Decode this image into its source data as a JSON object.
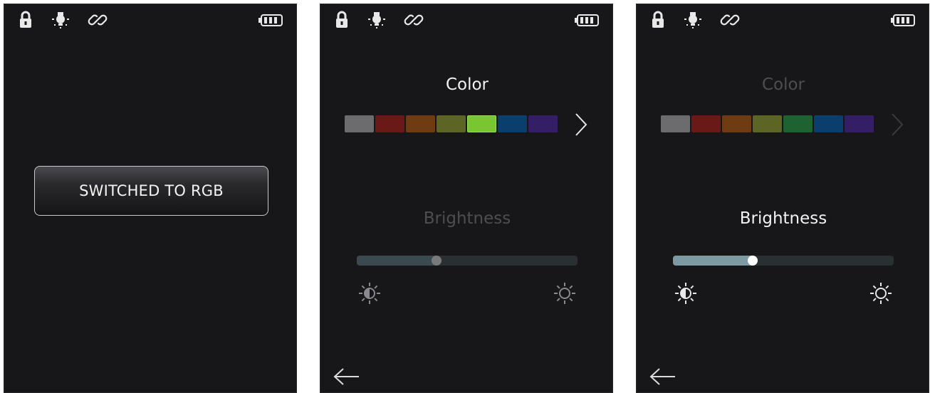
{
  "colors": {
    "screen_bg": "#171618",
    "text_active": "#f2f2f2",
    "text_dim": "#4e4d52",
    "icon_active": "#e8e8e8",
    "icon_dim": "#8a8a8e"
  },
  "icons": {
    "status": [
      "lock-icon",
      "bulb-icon",
      "link-icon",
      "battery-icon"
    ],
    "slider_low": "sun-half-icon",
    "slider_high": "sun-outline-icon",
    "next": "chevron-right-icon",
    "back": "arrow-left-icon"
  },
  "screen1": {
    "button_label": "SWITCHED TO RGB"
  },
  "screen2": {
    "color_title": "Color",
    "brightness_title": "Brightness",
    "focus": "color",
    "selected_swatch": 4,
    "brightness_level": 0.36,
    "swatches": [
      "#6c6c6e",
      "#6a1916",
      "#6e3b12",
      "#5c6524",
      "#7ac631",
      "#0a3e6c",
      "#341f66"
    ]
  },
  "screen3": {
    "color_title": "Color",
    "brightness_title": "Brightness",
    "focus": "brightness",
    "brightness_level": 0.36,
    "swatches": [
      "#6c6c6e",
      "#6a1916",
      "#6e3b12",
      "#5c6524",
      "#1e6232",
      "#0a3e6c",
      "#341f66"
    ]
  }
}
